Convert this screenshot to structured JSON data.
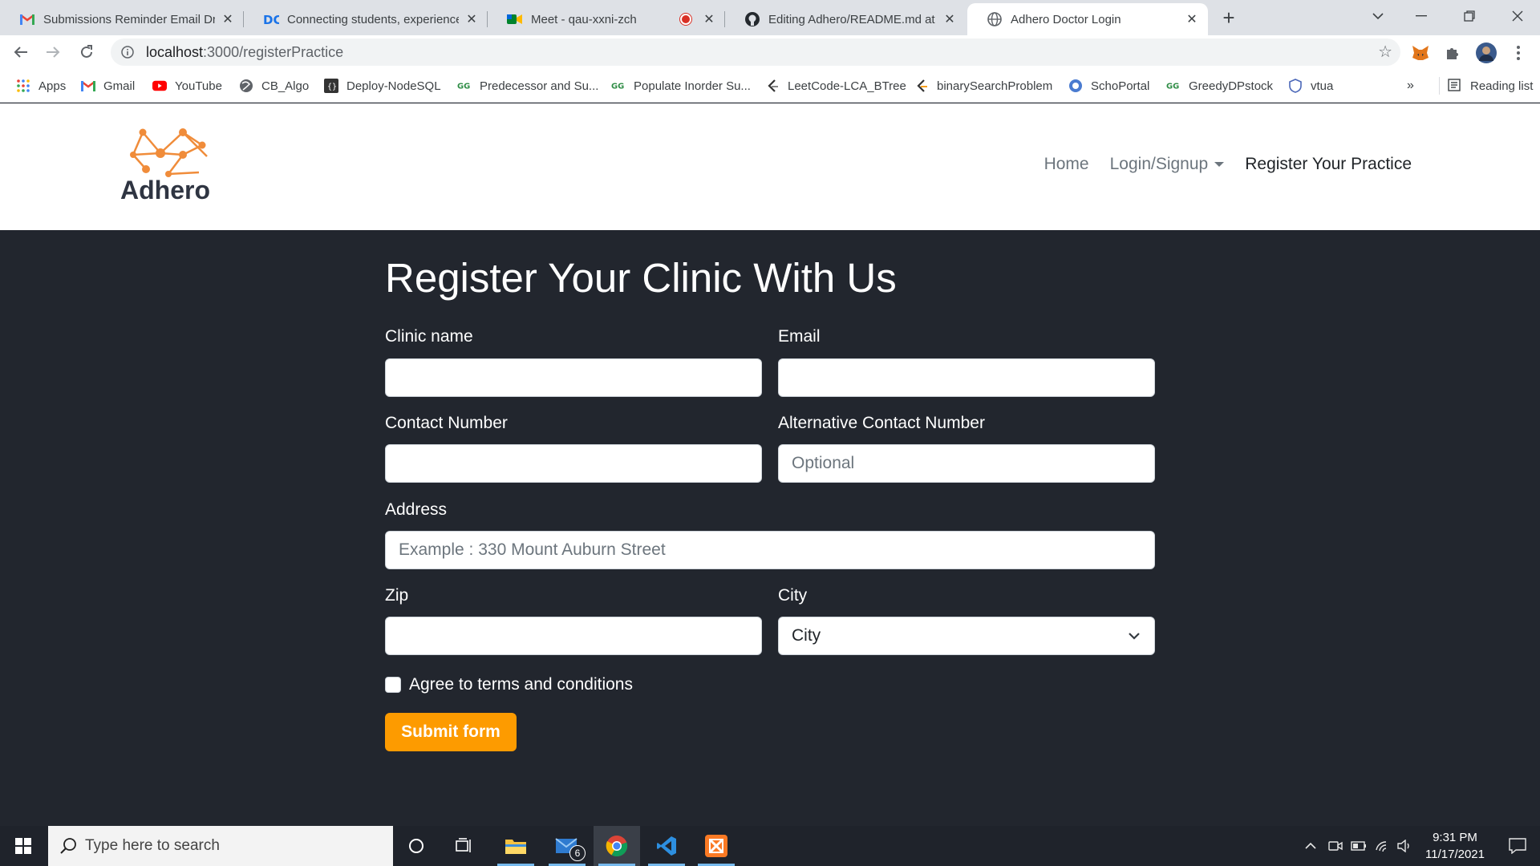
{
  "browser": {
    "tabs": [
      {
        "title": "Submissions Reminder Email Dra",
        "icon": "gmail-icon"
      },
      {
        "title": "Connecting students, experience",
        "icon": "dc-icon"
      },
      {
        "title": "Meet - qau-xxni-zch",
        "icon": "meet-icon"
      },
      {
        "title": "Editing Adhero/README.md at m",
        "icon": "github-icon"
      },
      {
        "title": "Adhero Doctor Login",
        "icon": "globe-icon"
      }
    ],
    "url_host": "localhost",
    "url_path": ":3000/registerPractice",
    "bookmarks": [
      {
        "label": "Apps"
      },
      {
        "label": "Gmail"
      },
      {
        "label": "YouTube"
      },
      {
        "label": "CB_Algo"
      },
      {
        "label": "Deploy-NodeSQL"
      },
      {
        "label": "Predecessor and Su..."
      },
      {
        "label": "Populate Inorder Su..."
      },
      {
        "label": "LeetCode-LCA_BTree"
      },
      {
        "label": "binarySearchProblem"
      },
      {
        "label": "SchoPortal"
      },
      {
        "label": "GreedyDPstock"
      },
      {
        "label": "vtua"
      }
    ],
    "bookmarks_more": "»",
    "reading_list": "Reading list"
  },
  "site": {
    "brand": "Adhero",
    "nav": {
      "home": "Home",
      "login": "Login/Signup",
      "register": "Register Your Practice"
    }
  },
  "form": {
    "title": "Register Your Clinic With Us",
    "clinic_label": "Clinic name",
    "email_label": "Email",
    "contact_label": "Contact Number",
    "alt_contact_label": "Alternative Contact Number",
    "alt_contact_placeholder": "Optional",
    "address_label": "Address",
    "address_placeholder": "Example : 330 Mount Auburn Street",
    "zip_label": "Zip",
    "city_label": "City",
    "city_selected": "City",
    "terms_label": "Agree to terms and conditions",
    "submit_label": "Submit form"
  },
  "taskbar": {
    "search_placeholder": "Type here to search",
    "mail_badge": "6",
    "time": "9:31 PM",
    "date": "11/17/2021"
  },
  "colors": {
    "page_background": "#22262e",
    "accent": "#fd9b00",
    "header_background": "#ffffff"
  }
}
